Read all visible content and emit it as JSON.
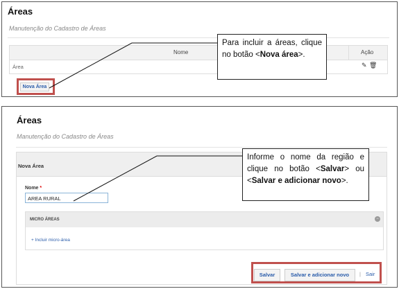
{
  "panel1": {
    "title": "Áreas",
    "subtitle": "Manutenção do Cadastro de Áreas",
    "table": {
      "headers": [
        "Nome",
        "Ação"
      ],
      "rows": [
        {
          "name": "Área"
        }
      ]
    },
    "new_area_button": "Nova Área",
    "callout": {
      "pre": "Para incluir a áreas, clique no botão <",
      "bold": "Nova área",
      "post": ">."
    }
  },
  "panel2": {
    "title": "Áreas",
    "subtitle": "Manutenção do Cadastro de Áreas",
    "form_header": "Nova Área",
    "name_label": "Nome",
    "required_mark": "*",
    "name_value": "AREA RURAL",
    "micro_header": "MICRO ÁREAS",
    "add_micro_link": "+ Incluir micro-área",
    "save_button": "Salvar",
    "save_add_button": "Salvar e adicionar novo",
    "separator": "|",
    "exit_link": "Sair",
    "callout": {
      "p1": "Informe o nome da região e clique no botão <",
      "b1": "Salvar",
      "p2": "> ou <",
      "b2": "Salvar e adicionar novo",
      "p3": ">."
    }
  },
  "colors": {
    "highlight": "#c0504d",
    "link": "#2a5caa"
  }
}
